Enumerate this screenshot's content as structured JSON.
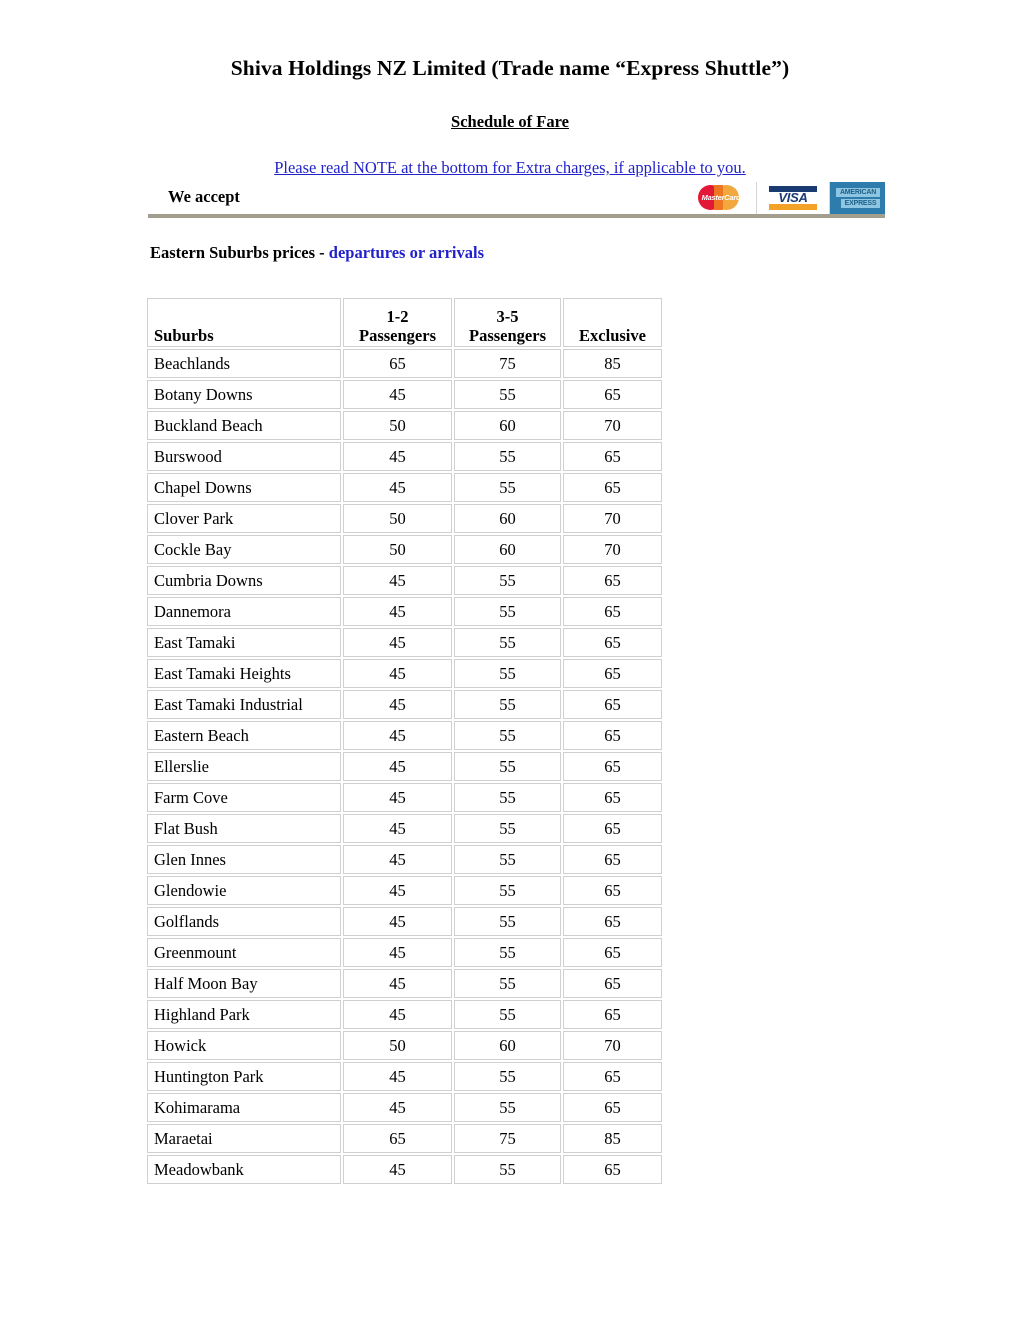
{
  "document": {
    "title": "Shiva Holdings NZ Limited (Trade name “Express Shuttle”)",
    "subtitle": "Schedule of Fare",
    "note_link": "Please read NOTE at the bottom for Extra charges, if applicable to you.",
    "we_accept_label": "We accept",
    "section_heading_black": "Eastern Suburbs prices - ",
    "section_heading_accent": "departures or arrivals"
  },
  "cards": [
    {
      "name": "mastercard-logo",
      "text": "MasterCard"
    },
    {
      "name": "visa-logo",
      "text": "VISA"
    },
    {
      "name": "amex-logo",
      "line1": "AMERICAN",
      "line2": "EXPRESS"
    }
  ],
  "colors": {
    "link_blue": "#2222cc",
    "accent_blue": "#2222cc",
    "rule_tan": "#a39f8f",
    "mastercard_red": "#e21836",
    "mastercard_orange": "#f2a83c",
    "visa_navy": "#1a3a72",
    "visa_gold": "#f3a227",
    "amex_blue": "#2e7cab",
    "cell_border": "#d0d0d0"
  },
  "fare_table": {
    "columns": [
      {
        "top": "",
        "bottom": "Suburbs"
      },
      {
        "top": "1-2",
        "bottom": "Passengers"
      },
      {
        "top": "3-5",
        "bottom": "Passengers"
      },
      {
        "top": "",
        "bottom": "Exclusive"
      }
    ],
    "rows": [
      {
        "suburb": "Beachlands",
        "p12": "65",
        "p35": "75",
        "exclusive": "85"
      },
      {
        "suburb": "Botany Downs",
        "p12": "45",
        "p35": "55",
        "exclusive": "65"
      },
      {
        "suburb": "Buckland Beach",
        "p12": "50",
        "p35": "60",
        "exclusive": "70"
      },
      {
        "suburb": "Burswood",
        "p12": "45",
        "p35": "55",
        "exclusive": "65"
      },
      {
        "suburb": "Chapel Downs",
        "p12": "45",
        "p35": "55",
        "exclusive": "65"
      },
      {
        "suburb": "Clover Park",
        "p12": "50",
        "p35": "60",
        "exclusive": "70"
      },
      {
        "suburb": "Cockle Bay",
        "p12": "50",
        "p35": "60",
        "exclusive": "70"
      },
      {
        "suburb": "Cumbria Downs",
        "p12": "45",
        "p35": "55",
        "exclusive": "65"
      },
      {
        "suburb": "Dannemora",
        "p12": "45",
        "p35": "55",
        "exclusive": "65"
      },
      {
        "suburb": "East Tamaki",
        "p12": "45",
        "p35": "55",
        "exclusive": "65"
      },
      {
        "suburb": "East Tamaki Heights",
        "p12": "45",
        "p35": "55",
        "exclusive": "65"
      },
      {
        "suburb": "East Tamaki Industrial",
        "p12": "45",
        "p35": "55",
        "exclusive": "65"
      },
      {
        "suburb": "Eastern Beach",
        "p12": "45",
        "p35": "55",
        "exclusive": "65"
      },
      {
        "suburb": "Ellerslie",
        "p12": "45",
        "p35": "55",
        "exclusive": "65"
      },
      {
        "suburb": "Farm Cove",
        "p12": "45",
        "p35": "55",
        "exclusive": "65"
      },
      {
        "suburb": "Flat Bush",
        "p12": "45",
        "p35": "55",
        "exclusive": "65"
      },
      {
        "suburb": "Glen Innes",
        "p12": "45",
        "p35": "55",
        "exclusive": "65"
      },
      {
        "suburb": "Glendowie",
        "p12": "45",
        "p35": "55",
        "exclusive": "65"
      },
      {
        "suburb": "Golflands",
        "p12": "45",
        "p35": "55",
        "exclusive": "65"
      },
      {
        "suburb": "Greenmount",
        "p12": "45",
        "p35": "55",
        "exclusive": "65"
      },
      {
        "suburb": "Half Moon Bay",
        "p12": "45",
        "p35": "55",
        "exclusive": "65"
      },
      {
        "suburb": "Highland Park",
        "p12": "45",
        "p35": "55",
        "exclusive": "65"
      },
      {
        "suburb": "Howick",
        "p12": "50",
        "p35": "60",
        "exclusive": "70"
      },
      {
        "suburb": "Huntington Park",
        "p12": "45",
        "p35": "55",
        "exclusive": "65"
      },
      {
        "suburb": "Kohimarama",
        "p12": "45",
        "p35": "55",
        "exclusive": "65"
      },
      {
        "suburb": "Maraetai",
        "p12": "65",
        "p35": "75",
        "exclusive": "85"
      },
      {
        "suburb": "Meadowbank",
        "p12": "45",
        "p35": "55",
        "exclusive": "65"
      }
    ]
  }
}
